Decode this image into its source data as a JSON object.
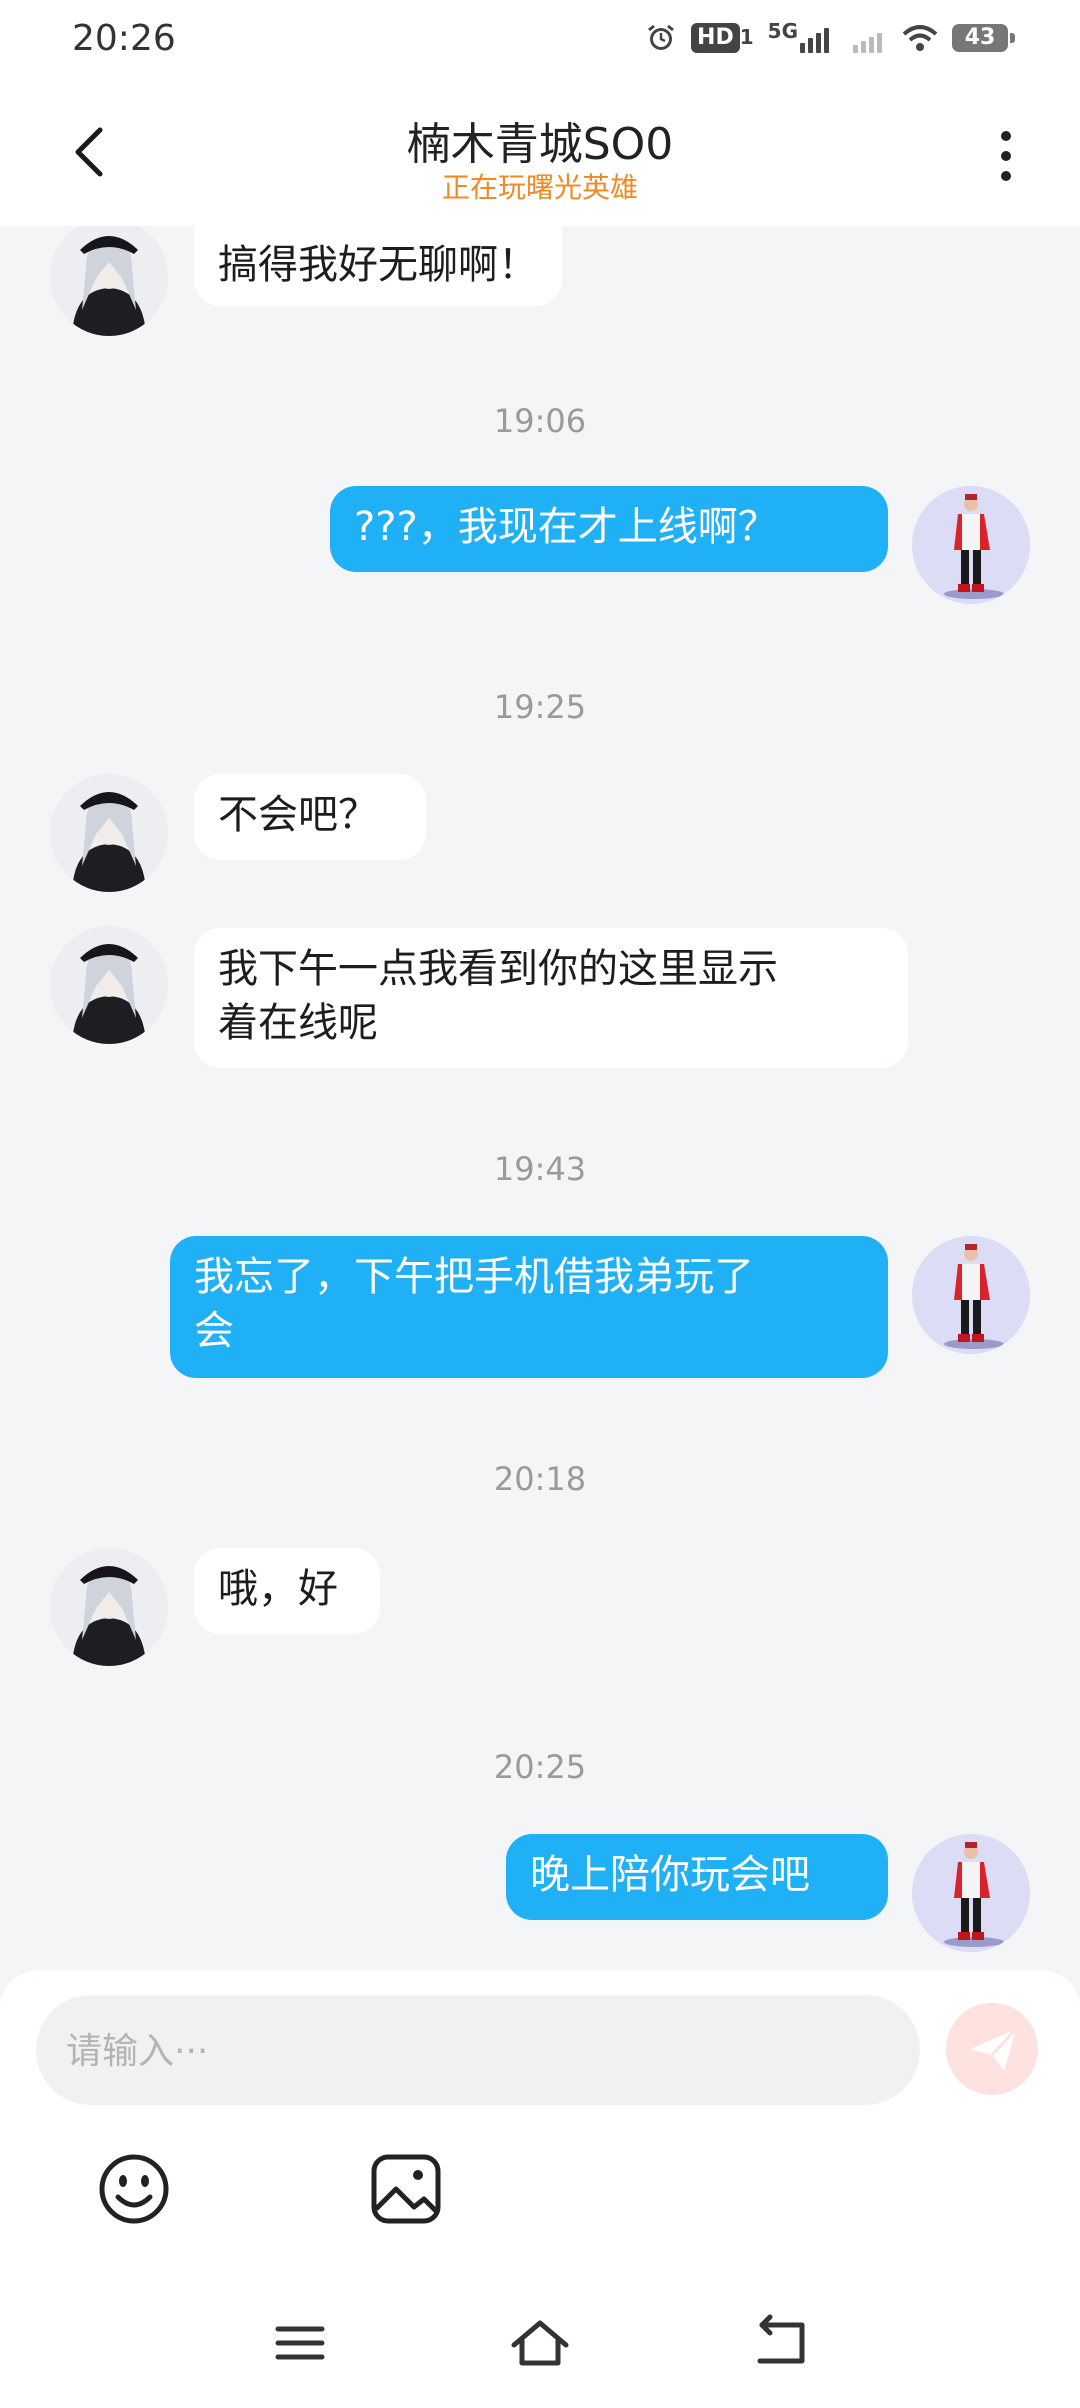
{
  "status_bar": {
    "time": "20:26",
    "hd_badge": "HD",
    "hd_sub": "1",
    "network": "5G",
    "battery": "43",
    "icons": [
      "alarm-icon",
      "hd-icon",
      "signal-5g-icon",
      "signal-icon",
      "wifi-icon",
      "battery-icon"
    ]
  },
  "header": {
    "title": "楠木青城SO0",
    "subtitle": "正在玩曙光英雄",
    "back_icon": "chevron-left-icon",
    "more_icon": "more-vertical-icon",
    "subtitle_color": "#f08a24"
  },
  "messages": [
    {
      "side": "in",
      "text": "搞得我好无聊啊！"
    },
    {
      "timestamp": "19:06"
    },
    {
      "side": "out",
      "text": "???，我现在才上线啊？"
    },
    {
      "timestamp": "19:25"
    },
    {
      "side": "in",
      "text": "不会吧？"
    },
    {
      "side": "in",
      "text_line1": "我下午一点我看到你的这里显示",
      "text_line2": "着在线呢"
    },
    {
      "timestamp": "19:43"
    },
    {
      "side": "out",
      "text_line1": "我忘了，下午把手机借我弟玩了",
      "text_line2": "会"
    },
    {
      "timestamp": "20:18"
    },
    {
      "side": "in",
      "text": "哦，好"
    },
    {
      "timestamp": "20:25"
    },
    {
      "side": "out",
      "text": "晚上陪你玩会吧"
    }
  ],
  "input": {
    "placeholder": "请输入···"
  },
  "toolbar": {
    "icons": [
      "emoji-icon",
      "image-icon",
      "send-icon"
    ]
  },
  "nav_bar": {
    "icons": [
      "menu-icon",
      "home-icon",
      "back-icon"
    ]
  },
  "colors": {
    "bubble_out": "#1fb0f5",
    "bubble_in": "#ffffff",
    "background": "#f4f5f7",
    "send_button": "#fde2df"
  }
}
